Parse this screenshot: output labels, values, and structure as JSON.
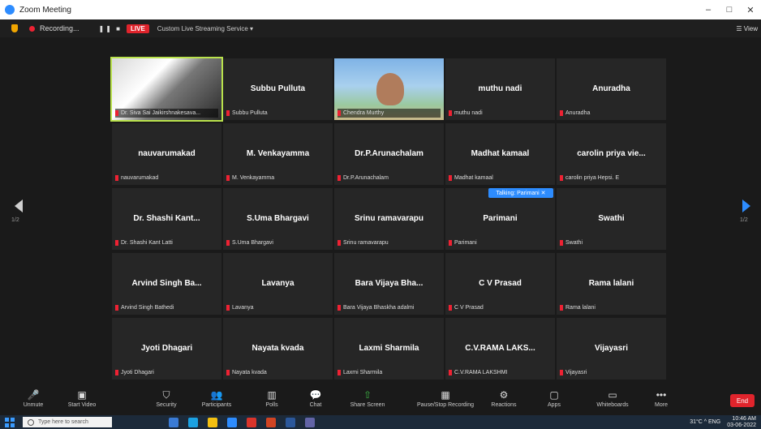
{
  "window": {
    "title": "Zoom Meeting",
    "controls": [
      "–",
      "□",
      "✕"
    ]
  },
  "meeting_bar": {
    "recording": "Recording...",
    "pause_resume": "❚❚ ■",
    "live_badge": "LIVE",
    "stream_label": "Custom Live Streaming Service ▾",
    "view_label": "☰ View"
  },
  "participants": [
    {
      "name": "",
      "label": "Dr. Siva Sai Jaikirshnakesava...",
      "video": "room"
    },
    {
      "name": "Subbu Pulluta",
      "label": "Subbu Pulluta",
      "video": ""
    },
    {
      "name": "",
      "label": "Chendra Murthy",
      "video": "beach"
    },
    {
      "name": "muthu nadi",
      "label": "muthu nadi",
      "video": ""
    },
    {
      "name": "Anuradha",
      "label": "Anuradha",
      "video": ""
    },
    {
      "name": "nauvarumakad",
      "label": "nauvarumakad",
      "video": ""
    },
    {
      "name": "M. Venkayamma",
      "label": "M. Venkayamma",
      "video": ""
    },
    {
      "name": "Dr.P.Arunachalam",
      "label": "Dr.P.Arunachalam",
      "video": ""
    },
    {
      "name": "Madhat kamaal",
      "label": "Madhat kamaal",
      "video": ""
    },
    {
      "name": "carolin priya vie...",
      "label": "carolin priya Hepsi. E",
      "video": ""
    },
    {
      "name": "Dr. Shashi Kant...",
      "label": "Dr. Shashi Kant Latti",
      "video": ""
    },
    {
      "name": "S.Uma Bhargavi",
      "label": "S.Uma Bhargavi",
      "video": ""
    },
    {
      "name": "Srinu ramavarapu",
      "label": "Srinu ramavarapu",
      "video": ""
    },
    {
      "name": "Parimani",
      "label": "Parimani",
      "video": ""
    },
    {
      "name": "Swathi",
      "label": "Swathi",
      "video": ""
    },
    {
      "name": "Arvind Singh Ba...",
      "label": "Arvind Singh Bathedi",
      "video": ""
    },
    {
      "name": "Lavanya",
      "label": "Lavanya",
      "video": ""
    },
    {
      "name": "Bara Vijaya Bha...",
      "label": "Bara Vijaya Bhaskha adalmi",
      "video": ""
    },
    {
      "name": "C V Prasad",
      "label": "C V Prasad",
      "video": ""
    },
    {
      "name": "Rama lalani",
      "label": "Rama lalani",
      "video": ""
    },
    {
      "name": "Jyoti Dhagari",
      "label": "Jyoti Dhagari",
      "video": ""
    },
    {
      "name": "Nayata kvada",
      "label": "Nayata kvada",
      "video": ""
    },
    {
      "name": "Laxmi Sharmila",
      "label": "Laxmi Sharmila",
      "video": ""
    },
    {
      "name": "C.V.RAMA LAKS...",
      "label": "C.V.RAMA LAKSHMI",
      "video": ""
    },
    {
      "name": "Vijayasri",
      "label": "Vijayasri",
      "video": ""
    }
  ],
  "speaker_toast": "Talking: Parimani ✕",
  "pager": {
    "left": "1/2",
    "right": "1/2"
  },
  "toolbar": [
    {
      "icon": "🎤",
      "label": "Unmute"
    },
    {
      "icon": "▣",
      "label": "Start Video"
    },
    {
      "icon": "⛉",
      "label": "Security"
    },
    {
      "icon": "👥",
      "label": "Participants"
    },
    {
      "icon": "▥",
      "label": "Polls"
    },
    {
      "icon": "💬",
      "label": "Chat"
    },
    {
      "icon": "⇧",
      "label": "Share Screen"
    },
    {
      "icon": "▦",
      "label": "Pause/Stop Recording"
    },
    {
      "icon": "⚙",
      "label": "Reactions"
    },
    {
      "icon": "▢",
      "label": "Apps"
    },
    {
      "icon": "▭",
      "label": "Whiteboards"
    },
    {
      "icon": "•••",
      "label": "More"
    }
  ],
  "end_button": "End",
  "taskbar": {
    "search_placeholder": "Type here to search",
    "tray_text": "31°C  ^  ENG",
    "time": "10:46 AM",
    "date": "03-06-2022"
  },
  "colors": {
    "zoom_blue": "#2d8cff",
    "live_red": "#e0242c",
    "active_speaker": "#b9e24c"
  }
}
